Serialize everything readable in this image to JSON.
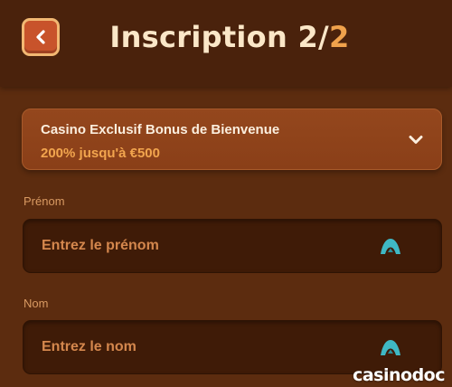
{
  "header": {
    "title_main": "Inscription 2/",
    "title_step": "2",
    "back_icon": "chevron-left-icon"
  },
  "bonus": {
    "title": "Casino Exclusif Bonus de Bienvenue",
    "subtitle": "200% jusqu'à €500",
    "toggle_icon": "chevron-down-icon"
  },
  "form": {
    "first_name": {
      "label": "Prénom",
      "placeholder": "Entrez le prénom",
      "value": "",
      "icon": "password-manager-icon"
    },
    "last_name": {
      "label": "Nom",
      "placeholder": "Entrez le nom",
      "value": "",
      "icon": "password-manager-icon"
    }
  },
  "watermark": "casinodoc",
  "colors": {
    "background": "#5c2c0f",
    "header": "#4a220c",
    "accent": "#f0a24c",
    "title_text": "#fbe7c8",
    "field_bg": "#3f1b07",
    "field_icon": "#3fb8c4"
  }
}
